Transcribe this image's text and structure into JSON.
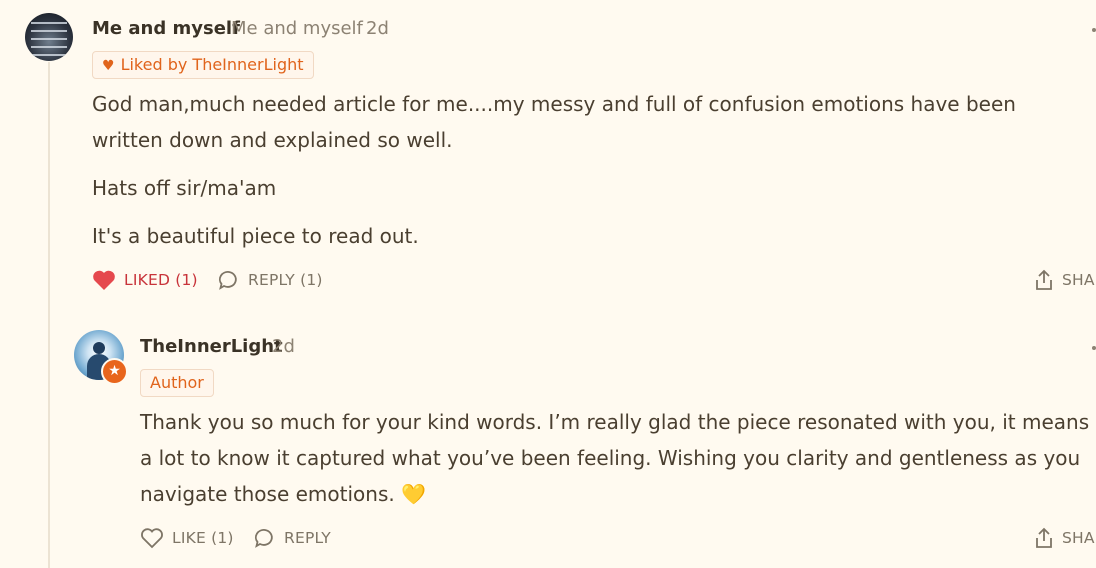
{
  "comment": {
    "author": "Me and myself",
    "handle": "Me and myself",
    "time": "2d",
    "liked_by": "Liked by TheInnerLight",
    "paragraphs": [
      "God man,much needed article for me....my messy and full of confusion emotions have been written down and explained so well.",
      "Hats off sir/ma'am",
      "It's a beautiful piece to read out."
    ],
    "actions": {
      "like": "LIKED (1)",
      "reply": "REPLY (1)",
      "share": "SHA"
    }
  },
  "reply": {
    "author": "TheInnerLight",
    "time": "2d",
    "badge": "Author",
    "text": "Thank you so much for your kind words. I’m really glad the piece resonated with you, it means a lot to know it captured what you’ve been feeling. Wishing you clarity and gentleness as you navigate those emotions.",
    "emoji": "💛",
    "actions": {
      "like": "LIKE (1)",
      "reply": "REPLY",
      "share": "SHA"
    }
  },
  "colors": {
    "accent": "#e0641c",
    "liked": "#c8333a",
    "background": "#fffaf0"
  }
}
